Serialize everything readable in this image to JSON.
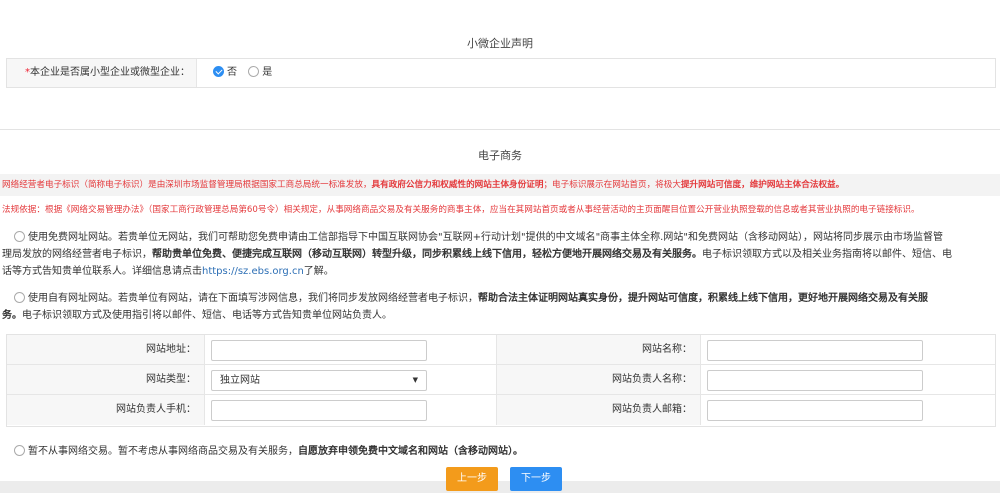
{
  "micro_section": {
    "title": "小微企业声明",
    "question_label": "本企业是否属小型企业或微型企业：",
    "required_mark": "*",
    "options": [
      {
        "label": "否",
        "checked": true
      },
      {
        "label": "是",
        "checked": false
      }
    ]
  },
  "ecommerce_section": {
    "title": "电子商务",
    "notice1_a": "网络经营者电子标识（简称电子标识）是由深圳市场监督管理局根据国家工商总局统一标准发放，",
    "notice1_b": "具有政府公信力和权威性的网站主体身份证明",
    "notice1_c": "；电子标识展示在网站首页，将极大",
    "notice1_d": "提升网站可信度，维护网站主体合法权益。",
    "notice2": "法规依据：根据《网络交易管理办法》（国家工商行政管理总局第60号令）相关规定，从事网络商品交易及有关服务的商事主体，应当在其网站首页或者从事经营活动的主页面醒目位置公开营业执照登载的信息或者其营业执照的电子链接标识。",
    "option_free": {
      "line1": "使用免费网址网站。若贵单位无网站，我们可帮助您免费申请由工信部指导下中国互联网协会\"互联网+行动计划\"提供的中文域名\"商事主体全称.网站\"和免费网站（含移动网站），网站将同步展示由市场监督管",
      "line2_a": "理局发放的网络经营者电子标识，",
      "line2_b": "帮助贵单位免费、便捷完成互联网（移动互联网）转型升级，同步积累线上线下信用，轻松方便地开展网络交易及有关服务。",
      "line2_c": "电子标识领取方式以及相关业务指南将以邮件、短信、电",
      "line3_a": "话等方式告知贵单位联系人。详细信息请点击",
      "line3_link": "https://sz.ebs.org.cn",
      "line3_b": "了解。"
    },
    "option_own": {
      "line1_a": "使用自有网址网站。若贵单位有网站，请在下面填写涉网信息，我们将同步发放网络经营者电子标识，",
      "line1_b": "帮助合法主体证明网站真实身份，提升网站可信度，积累线上线下信用，更好地开展网络交易及有关服",
      "line2_a": "务。",
      "line2_b": "电子标识领取方式及使用指引将以邮件、短信、电话等方式告知贵单位网站负责人。"
    },
    "fields": {
      "site_url_label": "网站地址：",
      "site_url_value": "",
      "site_name_label": "网站名称：",
      "site_name_value": "",
      "site_type_label": "网站类型：",
      "site_type_value": "独立网站",
      "manager_name_label": "网站负责人名称：",
      "manager_name_value": "",
      "manager_phone_label": "网站负责人手机：",
      "manager_phone_value": "",
      "manager_email_label": "网站负责人邮箱：",
      "manager_email_value": ""
    },
    "option_none": {
      "text_a": "暂不从事网络交易。暂不考虑从事网络商品交易及有关服务，",
      "text_b": "自愿放弃申领免费中文域名和网站（含移动网站）。"
    }
  },
  "buttons": {
    "prev": "上一步",
    "next": "下一步"
  }
}
